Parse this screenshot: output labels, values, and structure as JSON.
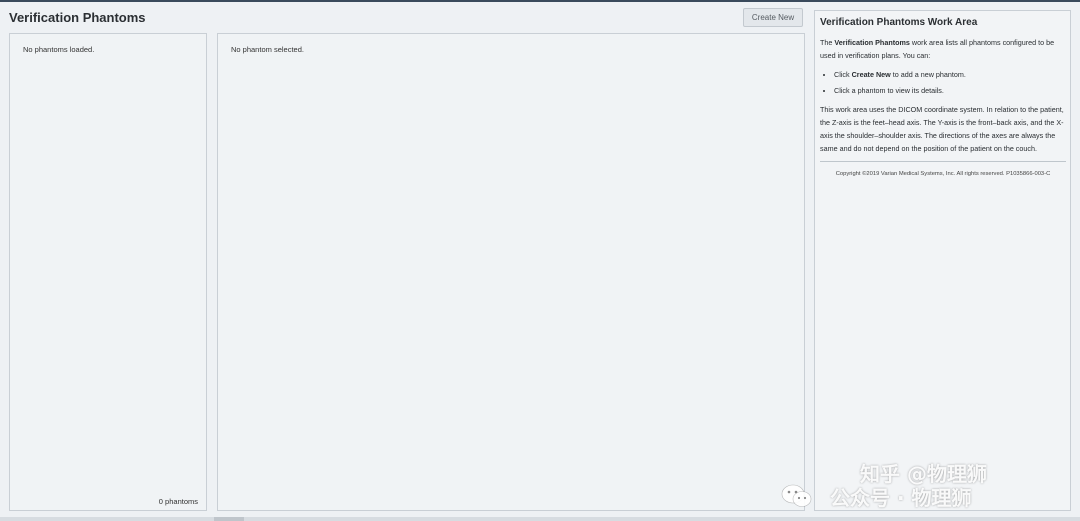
{
  "header": {
    "title": "Verification Phantoms",
    "create_new_label": "Create New"
  },
  "list_panel": {
    "empty_text": "No phantoms loaded.",
    "count_text": "0 phantoms"
  },
  "detail_panel": {
    "empty_text": "No phantom selected."
  },
  "help": {
    "title": "Verification Phantoms Work Area",
    "intro_prefix": "The ",
    "intro_bold": "Verification Phantoms",
    "intro_suffix": " work area lists all phantoms configured to be used in verification plans. You can:",
    "bullet1_prefix": "Click ",
    "bullet1_bold": "Create New",
    "bullet1_suffix": " to add a new phantom.",
    "bullet2": "Click a phantom to view its details.",
    "coordinates_text": "This work area uses the DICOM coordinate system. In relation to the patient, the Z-axis is the feet–head axis. The Y-axis is the front–back axis, and the X-axis the shoulder–shoulder axis. The directions of the axes are always the same and do not depend on the position of the patient on the couch.",
    "copyright": "Copyright ©2019 Varian Medical Systems, Inc. All rights reserved. P1035866-003-C"
  },
  "watermark": {
    "line1": "知乎 @物理狮",
    "line2": "公众号 · 物理狮"
  },
  "colors": {
    "background": "#eef1f4",
    "panel_border": "#c9cfd5",
    "button_bg": "#e3e7eb"
  }
}
